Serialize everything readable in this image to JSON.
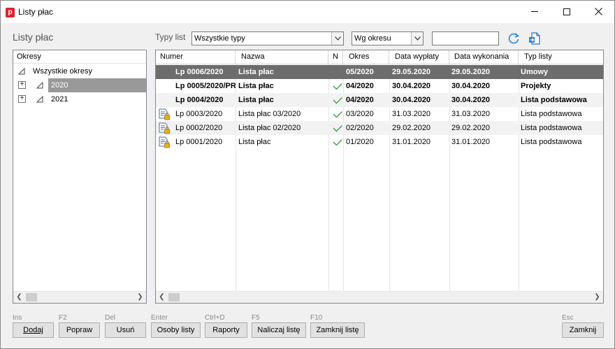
{
  "window": {
    "title": "Listy płac",
    "app_icon_letter": "p"
  },
  "left": {
    "section_title": "Listy płac",
    "tree_header": "Okresy",
    "tree_items": [
      {
        "label": "Wszystkie okresy",
        "expander": ""
      },
      {
        "label": "2020",
        "expander": "+"
      },
      {
        "label": "2021",
        "expander": "+"
      }
    ]
  },
  "filters": {
    "types_label": "Typy list",
    "types_value": "Wszystkie typy",
    "period_value": "Wg okresu",
    "search_value": ""
  },
  "grid": {
    "columns": [
      "Numer",
      "Nazwa",
      "N",
      "Okres",
      "Data wypłaty",
      "Data wykonania",
      "Typ listy"
    ],
    "rows": [
      {
        "numer": "Lp 0006/2020",
        "nazwa": "Lista płac",
        "n": "",
        "okres": "05/2020",
        "data_wyplaty": "29.05.2020",
        "data_wykonania": "29.05.2020",
        "typ": "Umowy"
      },
      {
        "numer": "Lp 0005/2020/PR",
        "nazwa": "Lista płac",
        "n": "check",
        "okres": "04/2020",
        "data_wyplaty": "30.04.2020",
        "data_wykonania": "30.04.2020",
        "typ": "Projekty"
      },
      {
        "numer": "Lp 0004/2020",
        "nazwa": "Lista płac",
        "n": "check",
        "okres": "04/2020",
        "data_wyplaty": "30.04.2020",
        "data_wykonania": "30.04.2020",
        "typ": "Lista podstawowa"
      },
      {
        "numer": "Lp 0003/2020",
        "nazwa": "Lista płac 03/2020",
        "n": "check",
        "okres": "03/2020",
        "data_wyplaty": "31.03.2020",
        "data_wykonania": "31.03.2020",
        "typ": "Lista podstawowa"
      },
      {
        "numer": "Lp 0002/2020",
        "nazwa": "Lista płac 02/2020",
        "n": "check",
        "okres": "02/2020",
        "data_wyplaty": "29.02.2020",
        "data_wykonania": "29.02.2020",
        "typ": "Lista podstawowa"
      },
      {
        "numer": "Lp 0001/2020",
        "nazwa": "Lista płac",
        "n": "check",
        "okres": "01/2020",
        "data_wyplaty": "31.01.2020",
        "data_wykonania": "31.01.2020",
        "typ": "Lista podstawowa"
      }
    ]
  },
  "buttons": {
    "dodaj": {
      "shortcut": "Ins",
      "label": "Dodaj"
    },
    "popraw": {
      "shortcut": "F2",
      "label": "Popraw"
    },
    "usun": {
      "shortcut": "Del",
      "label": "Usuń"
    },
    "osoby": {
      "shortcut": "Enter",
      "label": "Osoby listy"
    },
    "raporty": {
      "shortcut": "Ctrl+D",
      "label": "Raporty"
    },
    "naliczaj": {
      "shortcut": "F5",
      "label": "Naliczaj listę"
    },
    "zamknij_liste": {
      "shortcut": "F10",
      "label": "Zamknij listę"
    },
    "zamknij": {
      "shortcut": "Esc",
      "label": "Zamknij"
    }
  },
  "colors": {
    "selected_row": "#6d6d6d",
    "tree_selected": "#999999",
    "check": "#3aa04a",
    "refresh_icon": "#2e86d6"
  },
  "icons": {
    "refresh": "refresh-icon",
    "export": "export-icon",
    "locked_list": "locked-document-icon",
    "closed_check": "checkmark-icon"
  }
}
